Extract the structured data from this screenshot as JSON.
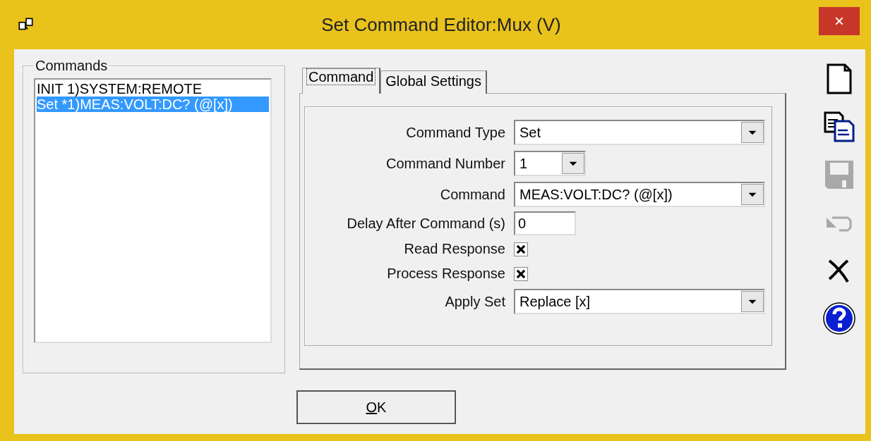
{
  "window": {
    "title": "Set Command Editor:Mux (V)",
    "close": "×"
  },
  "commands": {
    "label": "Commands",
    "items": [
      {
        "text": "INIT 1)SYSTEM:REMOTE",
        "selected": false
      },
      {
        "text": "Set *1)MEAS:VOLT:DC? (@[x])",
        "selected": true
      }
    ]
  },
  "tabs": [
    {
      "label": "Command",
      "selected": true
    },
    {
      "label": "Global Settings",
      "selected": false
    }
  ],
  "fields": [
    {
      "kind": "dropdown",
      "label": "Command Type",
      "value": "Set"
    },
    {
      "kind": "number_dropdown",
      "label": "Command Number",
      "value": "1"
    },
    {
      "kind": "dropdown",
      "label": "Command",
      "value": "MEAS:VOLT:DC? (@[x])"
    },
    {
      "kind": "text",
      "label": "Delay After Command (s)",
      "value": "0"
    },
    {
      "kind": "checkbox",
      "label": "Read Response",
      "checked": true
    },
    {
      "kind": "checkbox",
      "label": "Process Response",
      "checked": true
    },
    {
      "kind": "dropdown",
      "label": "Apply Set",
      "value": "Replace [x]"
    }
  ],
  "toolbar": [
    {
      "kind": "new",
      "disabled": false
    },
    {
      "kind": "copy",
      "disabled": false
    },
    {
      "kind": "save",
      "disabled": true
    },
    {
      "kind": "undo",
      "disabled": true
    },
    {
      "kind": "delete",
      "disabled": false
    },
    {
      "kind": "help",
      "disabled": false
    }
  ],
  "ok_button": "OK"
}
